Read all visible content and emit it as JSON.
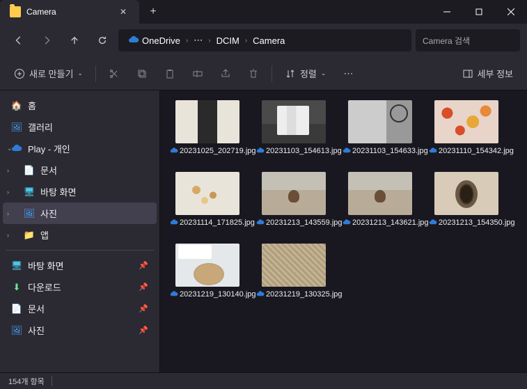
{
  "title": "Camera",
  "wincontrols": {
    "min": "min",
    "max": "max",
    "close": "close"
  },
  "nav": {
    "back": "back",
    "forward": "forward",
    "up": "up",
    "refresh": "refresh"
  },
  "breadcrumb": [
    "OneDrive",
    "⋯",
    "DCIM",
    "Camera"
  ],
  "search_placeholder": "Camera 검색",
  "toolbar": {
    "new": "새로 만들기",
    "sort": "정렬",
    "details": "세부 정보"
  },
  "sidebar": {
    "home": "홈",
    "gallery": "갤러리",
    "onedrive": "Play - 개인",
    "documents": "문서",
    "desktop": "바탕 화면",
    "pictures": "사진",
    "apps": "앱",
    "pin_desktop": "바탕 화면",
    "pin_downloads": "다운로드",
    "pin_documents": "문서",
    "pin_pictures": "사진"
  },
  "files": [
    {
      "name": "20231025_202719.jpg"
    },
    {
      "name": "20231103_154613.jpg"
    },
    {
      "name": "20231103_154633.jpg"
    },
    {
      "name": "20231110_154342.jpg"
    },
    {
      "name": "20231114_171825.jpg"
    },
    {
      "name": "20231213_143559.jpg"
    },
    {
      "name": "20231213_143621.jpg"
    },
    {
      "name": "20231213_154350.jpg"
    },
    {
      "name": "20231219_130140.jpg"
    },
    {
      "name": "20231219_130325.jpg"
    }
  ],
  "status": {
    "count": "154개 항목"
  }
}
